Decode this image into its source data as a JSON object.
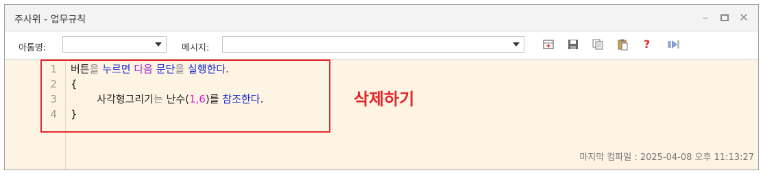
{
  "window": {
    "title": "주사위 - 업무규칙",
    "controls": [
      "minimize-icon",
      "maximize-icon",
      "close-icon"
    ]
  },
  "toolbar": {
    "nickname_label": "아톰명:",
    "nickname_value": "",
    "message_label": "메시지:",
    "message_value": "",
    "icons": [
      "insert-icon",
      "save-icon",
      "copy-icon",
      "paste-icon",
      "help-icon",
      "run-icon"
    ]
  },
  "editor": {
    "line_numbers": [
      "1",
      "2",
      "3",
      "4"
    ],
    "lines": [
      [
        {
          "text": "버튼",
          "style": "normal"
        },
        {
          "text": "을 ",
          "style": "gray"
        },
        {
          "text": "누르면 ",
          "style": "blue"
        },
        {
          "text": "다음 ",
          "style": "purple"
        },
        {
          "text": "문단",
          "style": "blue"
        },
        {
          "text": "을 ",
          "style": "gray"
        },
        {
          "text": "실행한다",
          "style": "blue"
        },
        {
          "text": ".",
          "style": "normal"
        }
      ],
      [
        {
          "text": "{",
          "style": "normal"
        }
      ],
      [
        {
          "text": "        사각형그리기",
          "style": "normal"
        },
        {
          "text": "는 ",
          "style": "gray"
        },
        {
          "text": "난수(",
          "style": "normal"
        },
        {
          "text": "1,6",
          "style": "magenta"
        },
        {
          "text": ")를 ",
          "style": "normal"
        },
        {
          "text": "참조한다",
          "style": "blue"
        },
        {
          "text": ".",
          "style": "normal"
        }
      ],
      [
        {
          "text": "}",
          "style": "normal"
        }
      ]
    ],
    "annotation": "삭제하기",
    "annotation_color": "#e3262a"
  },
  "status": {
    "last_compile": "마지막 컴파일 : 2025-04-08 오후 11:13:27"
  }
}
